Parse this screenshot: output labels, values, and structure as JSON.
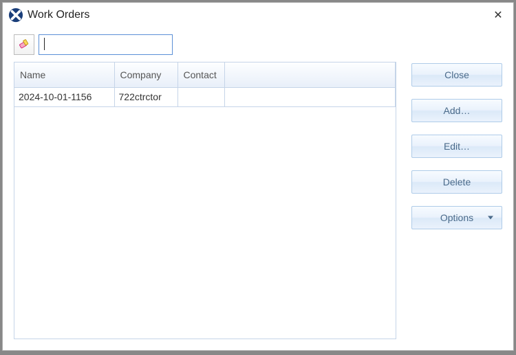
{
  "window": {
    "title": "Work Orders"
  },
  "search": {
    "value": "",
    "placeholder": ""
  },
  "table": {
    "columns": {
      "name": "Name",
      "company": "Company",
      "contact": "Contact"
    },
    "rows": [
      {
        "name": "2024-10-01-1156",
        "company": "722ctrctor",
        "contact": ""
      }
    ]
  },
  "buttons": {
    "close": "Close",
    "add": "Add…",
    "edit": "Edit…",
    "delete": "Delete",
    "options": "Options"
  },
  "icons": {
    "app": "app-x-icon",
    "close_x": "✕",
    "eraser": "eraser-icon",
    "dropdown": "chevron-down-icon"
  }
}
